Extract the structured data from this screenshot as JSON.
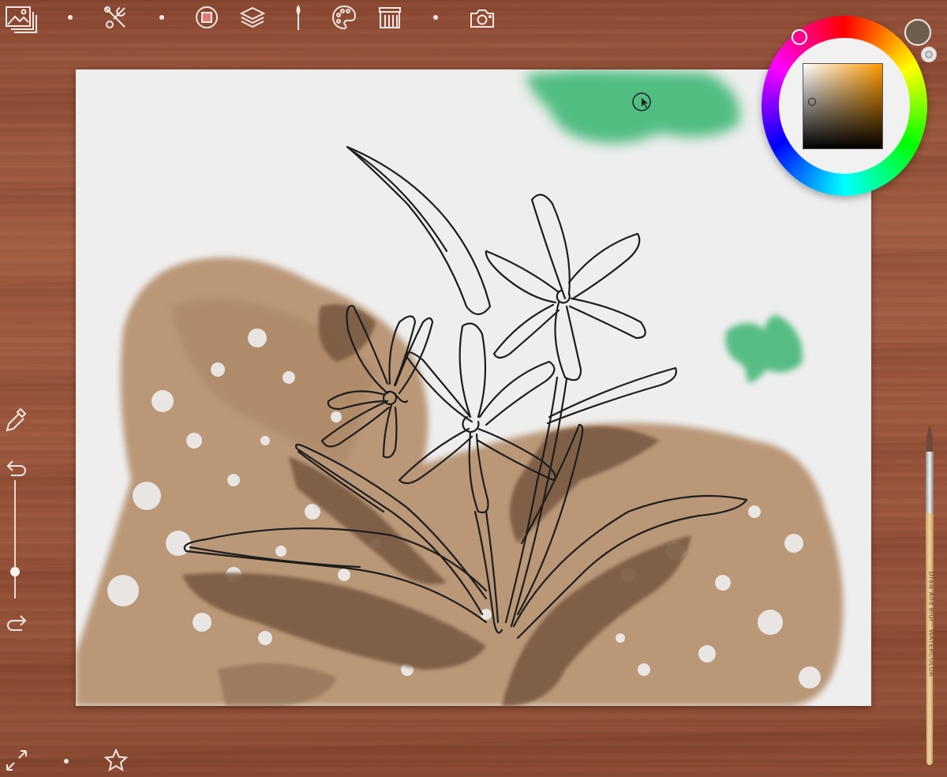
{
  "app": {
    "colors": {
      "wood": "#9a543a",
      "paper": "#eeeeee",
      "current_color": "#6e5f4d",
      "green_paint": "#2fb36a",
      "brown_paint": "#b38b6a",
      "dark_brown_paint": "#7a5a42",
      "icon_color": "#f3e8e2"
    }
  },
  "toolbar": {
    "icons": [
      "gallery-icon",
      "wrench-scissors-icon",
      "frame-icon",
      "layers-icon",
      "brush-icon",
      "palette-icon",
      "brushes-box-icon",
      "camera-icon"
    ]
  },
  "left_toolbar": {
    "icons": [
      "eyedropper-icon",
      "undo-icon",
      "redo-icon"
    ],
    "brush_size_fraction": 0.8
  },
  "bottom_toolbar": {
    "icons": [
      "fullscreen-icon",
      "favorite-star-icon"
    ]
  },
  "color_picker": {
    "hue": "orange",
    "selected_color": "#6e5f4d"
  },
  "paintbrush": {
    "label": "Draw And Blur · WATERCOLOR"
  }
}
